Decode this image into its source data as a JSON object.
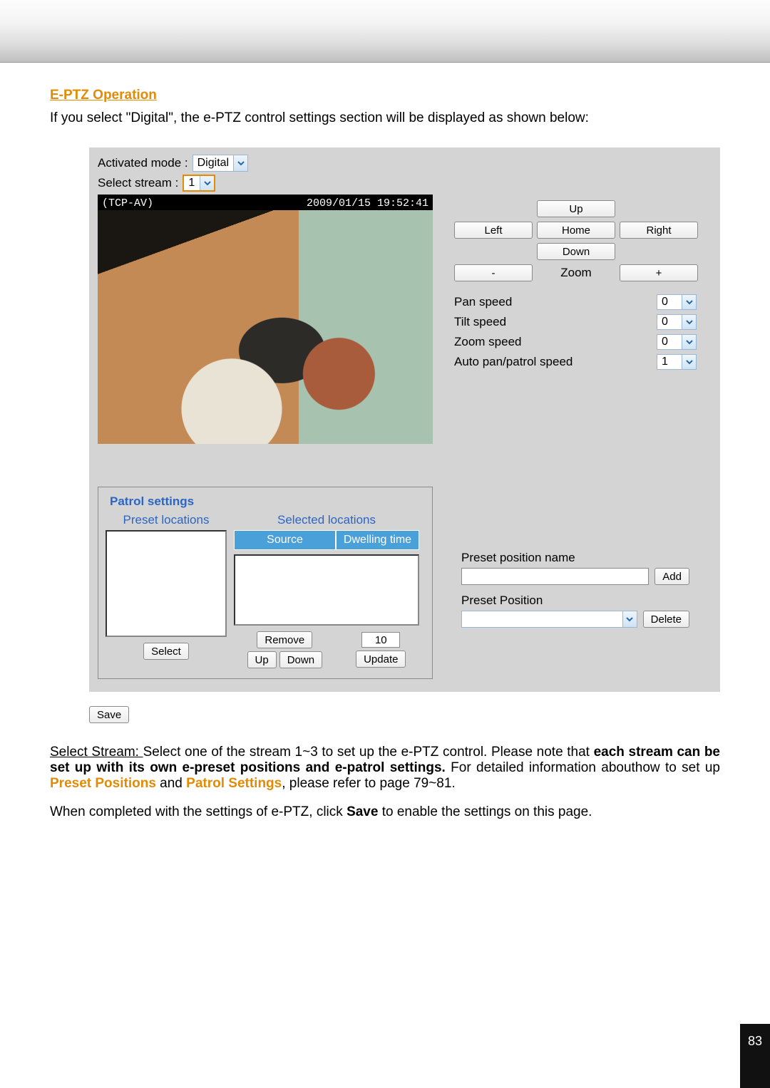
{
  "section_title": "E-PTZ Operation",
  "intro": "If you select \"Digital\", the e-PTZ control settings section will be displayed as shown below:",
  "controls": {
    "activated_mode_label": "Activated mode :",
    "activated_mode_value": "Digital",
    "select_stream_label": "Select stream :",
    "select_stream_value": "1"
  },
  "video": {
    "osd_left": "(TCP-AV)",
    "osd_right": "2009/01/15 19:52:41"
  },
  "ptz": {
    "up": "Up",
    "left": "Left",
    "home": "Home",
    "right": "Right",
    "down": "Down",
    "zoom": "Zoom",
    "minus": "-",
    "plus": "+",
    "speeds": [
      {
        "label": "Pan speed",
        "value": "0"
      },
      {
        "label": "Tilt speed",
        "value": "0"
      },
      {
        "label": "Zoom speed",
        "value": "0"
      },
      {
        "label": "Auto pan/patrol speed",
        "value": "1"
      }
    ]
  },
  "patrol": {
    "legend": "Patrol settings",
    "preset_header": "Preset locations",
    "selected_header": "Selected locations",
    "th_source": "Source",
    "th_dwelling": "Dwelling time",
    "select_btn": "Select",
    "remove_btn": "Remove",
    "up_btn": "Up",
    "down_btn": "Down",
    "dwell_value": "10",
    "update_btn": "Update"
  },
  "preset": {
    "name_label": "Preset position name",
    "add_btn": "Add",
    "position_label": "Preset Position",
    "delete_btn": "Delete"
  },
  "save_btn": "Save",
  "body": {
    "p1a": "Select Stream: ",
    "p1b": "Select one of the stream 1~3 to set up the e-PTZ control. Please note that ",
    "p1c": "each stream can be set up with its own e-preset positions and e-patrol settings.",
    "p1d": " For detailed information abouthow to set up ",
    "kw1": "Preset Positions",
    "mid": " and ",
    "kw2": "Patrol Settings",
    "p1e": ", please refer to page 79~81.",
    "p2a": "When completed with the settings of e-PTZ, click ",
    "p2b": "Save",
    "p2c": " to enable the settings on this page."
  },
  "page_number": "83"
}
